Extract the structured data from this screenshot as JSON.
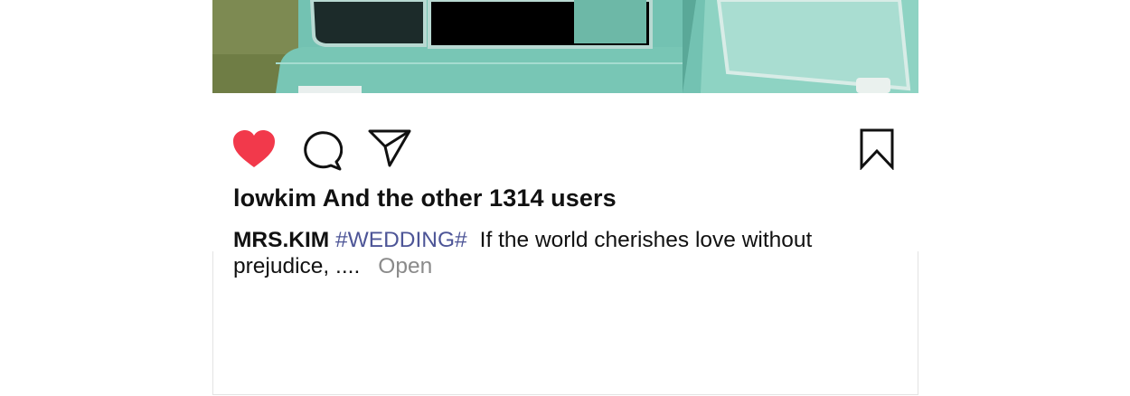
{
  "post": {
    "photo_alt": "teal-car-photo",
    "likes_text": "lowkim And the other 1314 users",
    "caption": {
      "username": "MRS.KIM",
      "hashtag": "#WEDDING#",
      "text": "If the world cherishes love without prejudice, ....",
      "more_label": "Open"
    }
  },
  "actions": {
    "like_icon": "heart-filled",
    "comment_icon": "speech-bubble",
    "share_icon": "paper-plane",
    "save_icon": "bookmark"
  },
  "colors": {
    "like_red": "#f2394b",
    "hashtag": "#4d5597",
    "more_gray": "#8a8a8a",
    "car_teal": "#6fbfb0"
  }
}
